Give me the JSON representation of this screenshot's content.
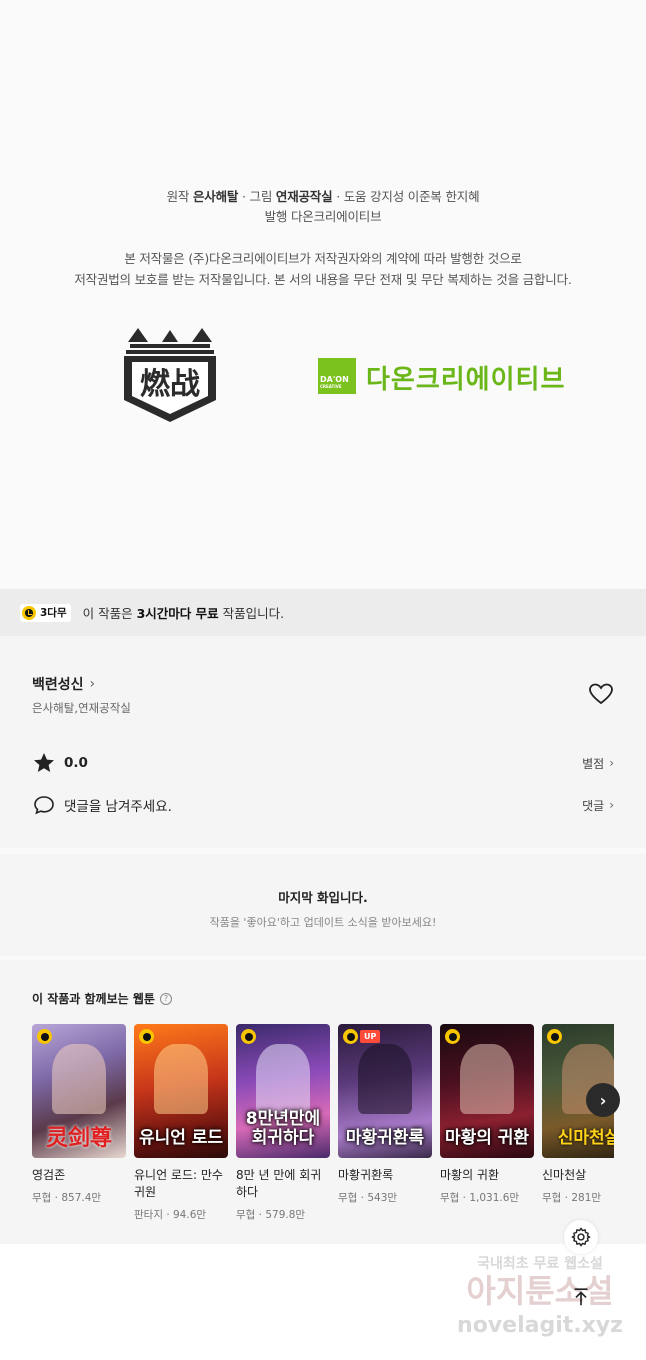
{
  "credits": {
    "line1": {
      "prefix1": "원작 ",
      "author": "은사해탈",
      "prefix2": " · 그림 ",
      "artist": "연재공작실",
      "suffix": " · 도움 강지성 이준복 한지혜"
    },
    "line2": "발행 다온크리에이티브",
    "notice1": "본 저작물은 (주)다온크리에이티브가 저작권자와의 계약에 따라 발행한 것으로",
    "notice2": "저작권법의 보호를 받는 저작물입니다. 본 서의 내용을 무단 전재 및 무단 복제하는 것을 금합니다.",
    "logo_right": {
      "mark_top": "DA'ON",
      "mark_bottom": "CREATIVE",
      "word": "다온크리에이티브"
    },
    "logo_left": {
      "text": "燃战"
    }
  },
  "free_bar": {
    "badge": "3다무",
    "text_prefix": "이 작품은 ",
    "text_bold": "3시간마다 무료",
    "text_suffix": " 작품입니다."
  },
  "info": {
    "title": "백련성신",
    "authors": "은사해탈,연재공작실",
    "rating": "0.0",
    "rating_link": "별점",
    "comment_prompt": "댓글을 남겨주세요.",
    "comment_link": "댓글"
  },
  "last_episode": {
    "heading": "마지막 화입니다.",
    "sub": "작품을 '좋아요'하고 업데이트 소식을 받아보세요!"
  },
  "recommend": {
    "heading": "이 작품과 함께보는 웹툰",
    "help": "?",
    "items": [
      {
        "name": "영검존",
        "meta": "무협 · 857.4만",
        "thumb_text": "灵剑尊",
        "up": ""
      },
      {
        "name": "유니언 로드: 만수귀원",
        "meta": "판타지 · 94.6만",
        "thumb_text": "유니언 로드",
        "up": ""
      },
      {
        "name": "8만 년 만에 회귀하다",
        "meta": "무협 · 579.8만",
        "thumb_text": "8만년만에 회귀하다",
        "up": ""
      },
      {
        "name": "마황귀환록",
        "meta": "무협 · 543만",
        "thumb_text": "마황귀환록",
        "up": "UP"
      },
      {
        "name": "마황의 귀환",
        "meta": "무협 · 1,031.6만",
        "thumb_text": "마황의 귀환",
        "up": ""
      },
      {
        "name": "신마천살",
        "meta": "무협 · 281만",
        "thumb_text": "신마천살",
        "up": ""
      }
    ]
  },
  "watermark": {
    "line1": "국내최초 무료 웹소설",
    "line2": "아지툰소설",
    "line3": "novelagit.xyz"
  }
}
